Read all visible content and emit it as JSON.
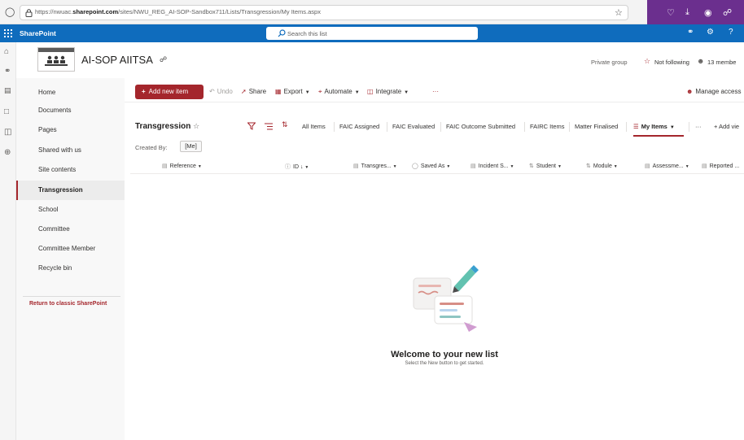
{
  "browser": {
    "url_prefix": "https://nwuac.",
    "url_domain": "sharepoint.com",
    "url_path": "/sites/NWU_REG_AI-SOP-Sandbox711/Lists/Transgression/My Items.aspx"
  },
  "suite": {
    "app_name": "SharePoint",
    "search_placeholder": "Search this list"
  },
  "site": {
    "title": "AI-SOP AIITSA",
    "privacy": "Private group",
    "follow_label": "Not following",
    "members_label": "13 membe"
  },
  "nav": {
    "items": [
      {
        "label": "Home"
      },
      {
        "label": "Documents"
      },
      {
        "label": "Pages"
      },
      {
        "label": "Shared with us"
      },
      {
        "label": "Site contents"
      },
      {
        "label": "Transgression"
      },
      {
        "label": "School"
      },
      {
        "label": "Committee"
      },
      {
        "label": "Committee Member"
      },
      {
        "label": "Recycle bin"
      }
    ],
    "classic_link": "Return to classic SharePoint"
  },
  "command_bar": {
    "new_item": "Add new item",
    "undo": "Undo",
    "share": "Share",
    "export": "Export",
    "automate": "Automate",
    "integrate": "Integrate",
    "more": "···",
    "manage_access": "Manage access"
  },
  "list": {
    "title": "Transgression",
    "views": [
      {
        "label": "All Items"
      },
      {
        "label": "FAIC Assigned"
      },
      {
        "label": "FAIC Evaluated"
      },
      {
        "label": "FAIC Outcome Submitted"
      },
      {
        "label": "FAIRC Items"
      },
      {
        "label": "Matter Finalised"
      },
      {
        "label": "My Items"
      }
    ],
    "more_views": "···",
    "add_view": "+ Add vie",
    "filter_label": "Created By:",
    "filter_value": "[Me]",
    "columns": [
      {
        "label": "Reference"
      },
      {
        "label": "ID"
      },
      {
        "label": "Transgres..."
      },
      {
        "label": "Saved As"
      },
      {
        "label": "Incident S..."
      },
      {
        "label": "Student"
      },
      {
        "label": "Module"
      },
      {
        "label": "Assessme..."
      },
      {
        "label": "Reported ..."
      }
    ]
  },
  "empty_state": {
    "title": "Welcome to your new list",
    "subtitle": "Select the New button to get started."
  },
  "colors": {
    "brand": "#0f6cbd",
    "accent": "#a4262c",
    "browser_ext": "#6b2f8e"
  },
  "icons": [
    "shield-icon",
    "lock-icon",
    "star-icon",
    "waffle-icon",
    "search-icon",
    "home-icon",
    "globe-icon",
    "news-icon",
    "file-icon",
    "database-icon",
    "add-circle-icon",
    "filter-icon",
    "chevron-down-icon",
    "sort-icon"
  ]
}
